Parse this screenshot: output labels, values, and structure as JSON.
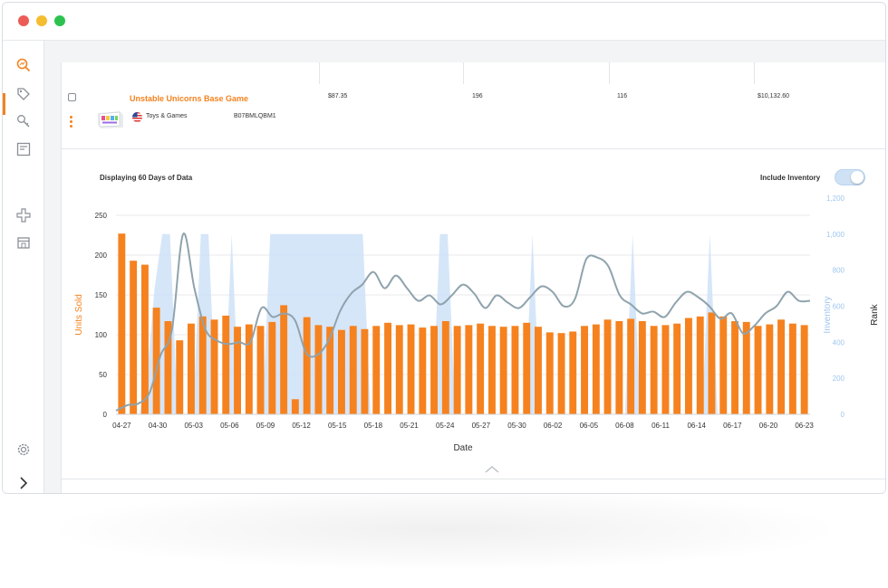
{
  "window": {
    "controls": [
      "close",
      "minimize",
      "maximize"
    ]
  },
  "sidebar": {
    "items": [
      {
        "icon": "search-chart-icon",
        "active": true
      },
      {
        "icon": "tag-icon",
        "active": false
      },
      {
        "icon": "key-search-icon",
        "active": false
      },
      {
        "icon": "board-icon",
        "active": false
      },
      {
        "icon": "plus-cross-icon",
        "active": false
      },
      {
        "icon": "store-icon",
        "active": false
      },
      {
        "icon": "settings-gear-icon",
        "active": false
      },
      {
        "icon": "chevron-right-icon",
        "active": false
      }
    ]
  },
  "product": {
    "title": "Unstable Unicorns Base Game",
    "category": "Toys & Games",
    "asin": "B07BMLQBM1",
    "price": "$87.35",
    "metric_2": "196",
    "metric_3": "116",
    "revenue": "$10,132.60"
  },
  "chart_header": {
    "display_label": "Displaying 60 Days of Data",
    "include_inventory_label": "Include Inventory",
    "include_inventory_on": true
  },
  "colors": {
    "accent": "#f5821f",
    "rank_line": "#8fa3ad",
    "inventory_fill": "#cfe2f8"
  },
  "chart_data": {
    "type": "bar",
    "xlabel": "Date",
    "ylabel_left": "Units Sold",
    "ylabel_inventory": "Inventory",
    "ylabel_rank": "Rank",
    "ylim": [
      0,
      250
    ],
    "y_ticks": [
      "0",
      "50",
      "100",
      "150",
      "200",
      "250"
    ],
    "y2lim": [
      0,
      1200
    ],
    "y2_ticks": [
      "0",
      "200",
      "400",
      "600",
      "800",
      "1,000",
      "1,200"
    ],
    "x_tick_labels": [
      "04-27",
      "04-30",
      "05-03",
      "05-06",
      "05-09",
      "05-12",
      "05-15",
      "05-18",
      "05-21",
      "05-24",
      "05-27",
      "05-30",
      "06-02",
      "06-05",
      "06-08",
      "06-11",
      "06-14",
      "06-17",
      "06-20",
      "06-23"
    ],
    "series": [
      {
        "name": "Units Sold",
        "kind": "bar",
        "values": [
          227,
          193,
          188,
          134,
          117,
          93,
          114,
          123,
          119,
          124,
          110,
          113,
          111,
          116,
          137,
          19,
          122,
          112,
          110,
          106,
          111,
          107,
          111,
          115,
          112,
          113,
          109,
          111,
          117,
          111,
          112,
          114,
          111,
          110,
          111,
          115,
          110,
          103,
          102,
          104,
          111,
          113,
          119,
          117,
          120,
          117,
          111,
          112,
          114,
          121,
          123,
          128,
          123,
          117,
          116,
          111,
          113,
          119,
          114,
          112
        ]
      },
      {
        "name": "Inventory",
        "kind": "area",
        "axis": "right",
        "values": [
          0,
          0,
          0,
          0,
          200,
          700,
          1000,
          1000,
          0,
          0,
          0,
          1000,
          1000,
          0,
          0,
          1000,
          0,
          0,
          0,
          0,
          1000,
          1000,
          1000,
          1000,
          1000,
          1000,
          1000,
          1000,
          1000,
          1000,
          1000,
          1000,
          1000,
          0,
          0,
          0,
          0,
          0,
          0,
          0,
          0,
          0,
          1000,
          1000,
          0,
          0,
          0,
          0,
          0,
          0,
          0,
          0,
          0,
          0,
          1000,
          0,
          0,
          0,
          0,
          0,
          0,
          0,
          0,
          0,
          0,
          0,
          0,
          1000,
          0,
          0,
          0,
          0,
          0,
          0,
          0,
          0,
          0,
          1000,
          0,
          0,
          0,
          0,
          0,
          0,
          0,
          0,
          0,
          0,
          0,
          0,
          0
        ]
      },
      {
        "name": "Rank",
        "kind": "line",
        "axis": "right",
        "values": [
          20,
          50,
          60,
          120,
          330,
          470,
          1000,
          700,
          470,
          410,
          390,
          400,
          400,
          590,
          540,
          560,
          520,
          340,
          330,
          410,
          570,
          670,
          720,
          790,
          700,
          770,
          700,
          630,
          660,
          610,
          660,
          720,
          670,
          590,
          660,
          620,
          590,
          650,
          710,
          680,
          600,
          640,
          860,
          870,
          820,
          660,
          610,
          560,
          570,
          540,
          620,
          680,
          650,
          600,
          530,
          560,
          450,
          490,
          560,
          600,
          680,
          630,
          630
        ]
      }
    ]
  }
}
